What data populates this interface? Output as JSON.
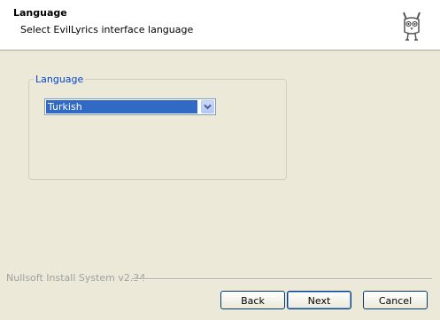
{
  "header": {
    "title": "Language",
    "subtitle": "Select EvilLyrics interface language",
    "icon": "owl-icon"
  },
  "language_group": {
    "legend": "Language",
    "select": {
      "value": "Turkish",
      "selected_color": "#316ac5"
    }
  },
  "footer": {
    "branding": "Nullsoft Install System v2.34",
    "back_label": "Back",
    "next_label": "Next",
    "cancel_label": "Cancel"
  }
}
